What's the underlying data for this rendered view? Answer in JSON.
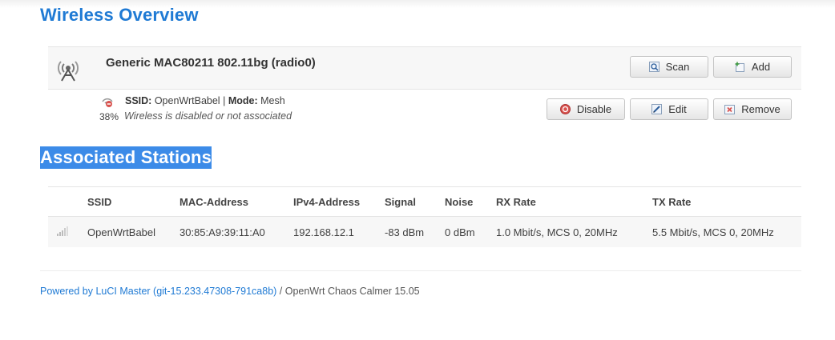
{
  "page_title": "Wireless Overview",
  "device": {
    "name": "Generic MAC80211 802.11bg (radio0)",
    "icon": "wifi-radio-icon",
    "buttons": {
      "scan": "Scan",
      "add": "Add"
    }
  },
  "network": {
    "ssid_label": "SSID:",
    "ssid": "OpenWrtBabel",
    "separator": "|",
    "mode_label": "Mode:",
    "mode": "Mesh",
    "signal_percent": "38%",
    "status": "Wireless is disabled or not associated",
    "icon": "wifi-disabled-icon",
    "buttons": {
      "disable": "Disable",
      "edit": "Edit",
      "remove": "Remove"
    }
  },
  "stations": {
    "title": "Associated Stations",
    "columns": [
      "SSID",
      "MAC-Address",
      "IPv4-Address",
      "Signal",
      "Noise",
      "RX Rate",
      "TX Rate"
    ],
    "rows": [
      {
        "icon": "signal-bars-icon",
        "ssid": "OpenWrtBabel",
        "mac": "30:85:A9:39:11:A0",
        "ipv4": "192.168.12.1",
        "signal": "-83 dBm",
        "noise": "0 dBm",
        "rx_rate": "1.0 Mbit/s, MCS 0, 20MHz",
        "tx_rate": "5.5 Mbit/s, MCS 0, 20MHz"
      }
    ]
  },
  "footer": {
    "link_text": "Powered by LuCI Master (git-15.233.47308-791ca8b)",
    "suffix": " / OpenWrt Chaos Calmer 15.05"
  },
  "colors": {
    "accent": "#1f7ad4",
    "selection": "#3c8be8"
  }
}
